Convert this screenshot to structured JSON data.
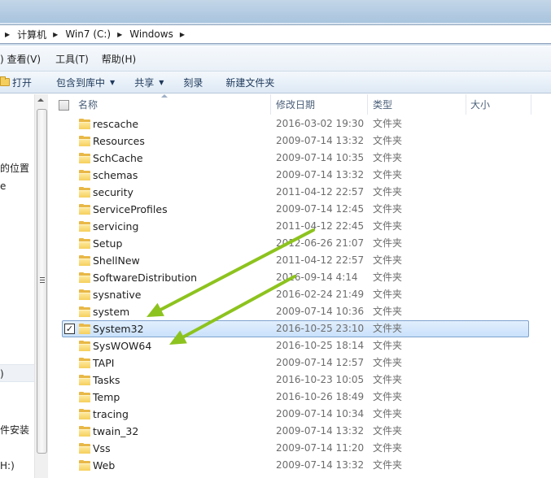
{
  "address": {
    "crumbs": [
      "计算机",
      "Win7 (C:)",
      "Windows"
    ]
  },
  "menu": {
    "items": [
      ") 查看(V)",
      "工具(T)",
      "帮助(H)"
    ]
  },
  "toolbar": {
    "open_label": "打开",
    "include_label": "包含到库中",
    "share_label": "共享",
    "burn_label": "刻录",
    "newfolder_label": "新建文件夹"
  },
  "nav": {
    "partial_texts": [
      "的位置",
      "e",
      ")",
      "件安装",
      "H:)"
    ]
  },
  "columns": {
    "name": "名称",
    "date": "修改日期",
    "type": "类型",
    "size": "大小"
  },
  "files": [
    {
      "name": "rescache",
      "date": "2016-03-02 19:30",
      "type": "文件夹"
    },
    {
      "name": "Resources",
      "date": "2009-07-14 13:32",
      "type": "文件夹"
    },
    {
      "name": "SchCache",
      "date": "2009-07-14 10:35",
      "type": "文件夹"
    },
    {
      "name": "schemas",
      "date": "2009-07-14 13:32",
      "type": "文件夹"
    },
    {
      "name": "security",
      "date": "2011-04-12 22:57",
      "type": "文件夹"
    },
    {
      "name": "ServiceProfiles",
      "date": "2009-07-14 12:45",
      "type": "文件夹"
    },
    {
      "name": "servicing",
      "date": "2011-04-12 22:45",
      "type": "文件夹"
    },
    {
      "name": "Setup",
      "date": "2012-06-26 21:07",
      "type": "文件夹"
    },
    {
      "name": "ShellNew",
      "date": "2011-04-12 22:57",
      "type": "文件夹"
    },
    {
      "name": "SoftwareDistribution",
      "date": "2016-09-14 4:14",
      "type": "文件夹"
    },
    {
      "name": "sysnative",
      "date": "2016-02-24 21:49",
      "type": "文件夹"
    },
    {
      "name": "system",
      "date": "2009-07-14 10:36",
      "type": "文件夹"
    },
    {
      "name": "System32",
      "date": "2016-10-25 23:10",
      "type": "文件夹",
      "selected": true,
      "check": "✓"
    },
    {
      "name": "SysWOW64",
      "date": "2016-10-25 18:14",
      "type": "文件夹"
    },
    {
      "name": "TAPI",
      "date": "2009-07-14 12:57",
      "type": "文件夹"
    },
    {
      "name": "Tasks",
      "date": "2016-10-23 10:05",
      "type": "文件夹"
    },
    {
      "name": "Temp",
      "date": "2016-10-26 18:49",
      "type": "文件夹"
    },
    {
      "name": "tracing",
      "date": "2009-07-14 10:34",
      "type": "文件夹"
    },
    {
      "name": "twain_32",
      "date": "2009-07-14 13:32",
      "type": "文件夹"
    },
    {
      "name": "Vss",
      "date": "2009-07-14 11:20",
      "type": "文件夹"
    },
    {
      "name": "Web",
      "date": "2009-07-14 13:32",
      "type": "文件夹"
    }
  ],
  "annotation": {
    "arrow_color": "#8dc31e"
  }
}
